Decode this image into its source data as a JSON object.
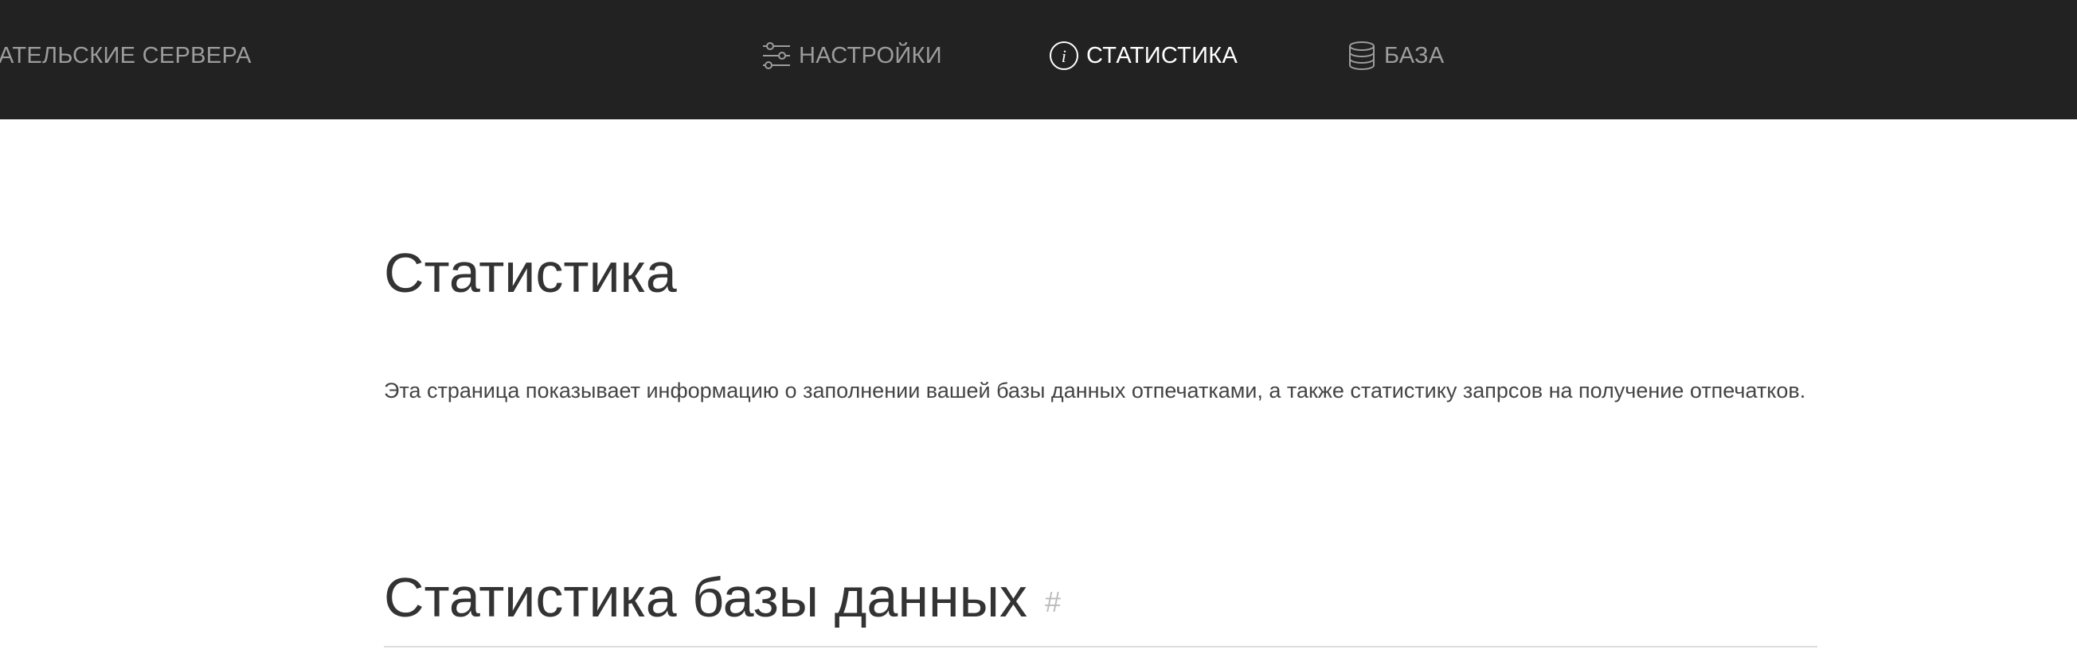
{
  "nav": {
    "servers_label": "АТЕЛЬСКИЕ СЕРВЕРА",
    "settings_label": "НАСТРОЙКИ",
    "stats_label": "СТАТИСТИКА",
    "database_label": "БАЗА",
    "active": "stats"
  },
  "page": {
    "title": "Статистика",
    "intro": "Эта страница показывает информацию о заполнении вашей базы данных отпечатками, а также статистику запрсов на получение отпечатков.",
    "section_title": "Статистика базы данных",
    "section_anchor": "#"
  },
  "colors": {
    "topbar_bg": "#222222",
    "nav_text": "#9d9d9d",
    "nav_active_text": "#ffffff",
    "heading_text": "#333333"
  },
  "icons": {
    "settings": "sliders-icon",
    "stats": "info-circle-icon",
    "database": "database-icon"
  }
}
